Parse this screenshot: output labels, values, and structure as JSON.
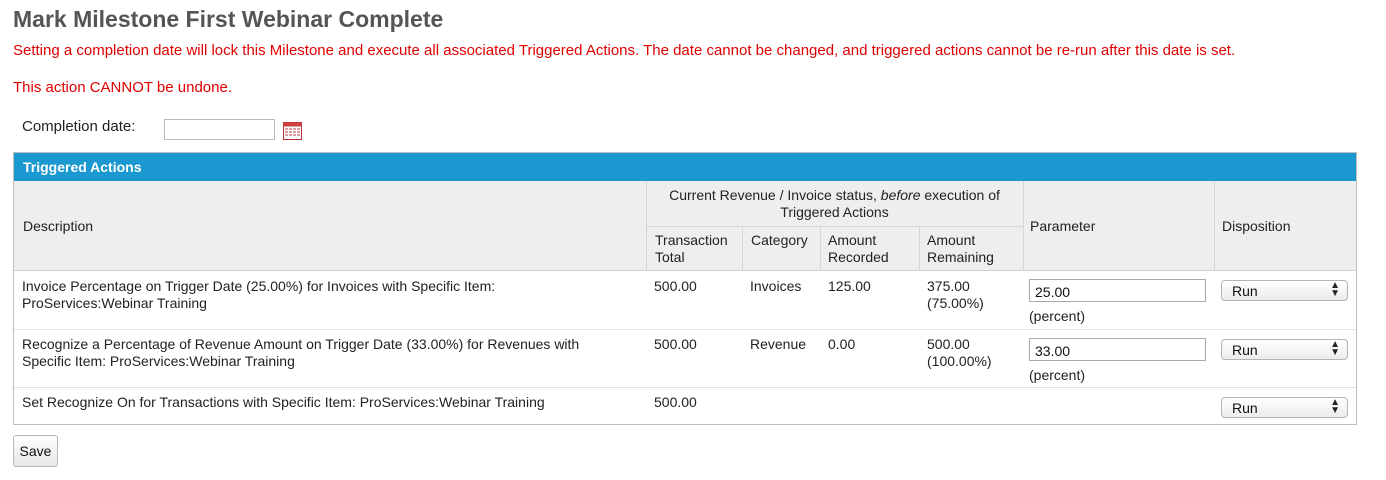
{
  "page": {
    "title": "Mark Milestone First Webinar Complete",
    "warning_1": "Setting a completion date will lock this Milestone and execute all associated Triggered Actions. The date cannot be changed, and triggered actions cannot be re-run after this date is set.",
    "warning_2": "This action CANNOT be undone."
  },
  "completion": {
    "label": "Completion date:",
    "value": ""
  },
  "panel": {
    "title": "Triggered Actions",
    "headers": {
      "description": "Description",
      "group_pre": "Current Revenue / Invoice status, ",
      "group_em": "before",
      "group_post": " execution of Triggered Actions",
      "transaction_total_1": "Transaction",
      "transaction_total_2": "Total",
      "category": "Category",
      "amount_recorded_1": "Amount",
      "amount_recorded_2": "Recorded",
      "amount_remaining_1": "Amount",
      "amount_remaining_2": "Remaining",
      "parameter": "Parameter",
      "disposition": "Disposition"
    },
    "rows": [
      {
        "description_1": "Invoice Percentage on Trigger Date (25.00%) for Invoices with Specific Item:",
        "description_2": "ProServices:Webinar Training",
        "transaction_total": "500.00",
        "category": "Invoices",
        "amount_recorded": "125.00",
        "amount_remaining_1": "375.00",
        "amount_remaining_2": "(75.00%)",
        "parameter_value": "25.00",
        "parameter_note": "(percent)",
        "disposition": "Run"
      },
      {
        "description_1": "Recognize a Percentage of Revenue Amount on Trigger Date (33.00%) for Revenues with",
        "description_2": "Specific Item: ProServices:Webinar Training",
        "transaction_total": "500.00",
        "category": "Revenue",
        "amount_recorded": "0.00",
        "amount_remaining_1": "500.00",
        "amount_remaining_2": "(100.00%)",
        "parameter_value": "33.00",
        "parameter_note": "(percent)",
        "disposition": "Run"
      },
      {
        "description_1": "Set Recognize On for Transactions with Specific Item: ProServices:Webinar Training",
        "transaction_total": "500.00",
        "disposition": "Run"
      }
    ]
  },
  "actions": {
    "save_label": "Save"
  },
  "icons": {
    "calendar": "calendar-icon",
    "select_arrows": "updown-arrows-icon"
  },
  "colors": {
    "warning": "#e00000",
    "panel_header": "#1b98cf",
    "title": "#555555"
  }
}
